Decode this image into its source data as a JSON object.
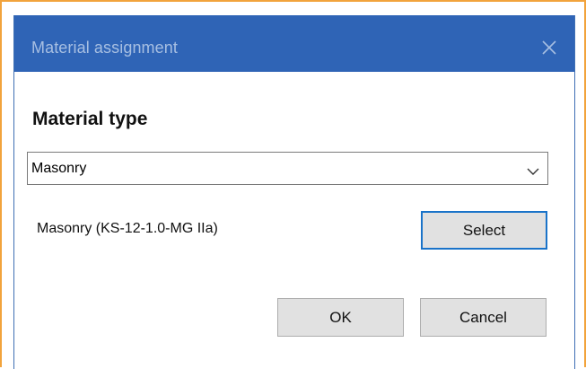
{
  "window": {
    "title": "Material assignment",
    "close_icon": "close-icon"
  },
  "material_type": {
    "heading": "Material type",
    "selected": "Masonry",
    "dropdown_icon": "chevron-down-icon"
  },
  "material": {
    "label": "Masonry (KS-12-1.0-MG IIa)",
    "select_label": "Select"
  },
  "actions": {
    "ok_label": "OK",
    "cancel_label": "Cancel"
  },
  "colors": {
    "titlebar": "#2f64b6",
    "title_text": "#a7bfe2",
    "focus_border": "#1a73c9",
    "frame_highlight": "#f2a33c"
  }
}
